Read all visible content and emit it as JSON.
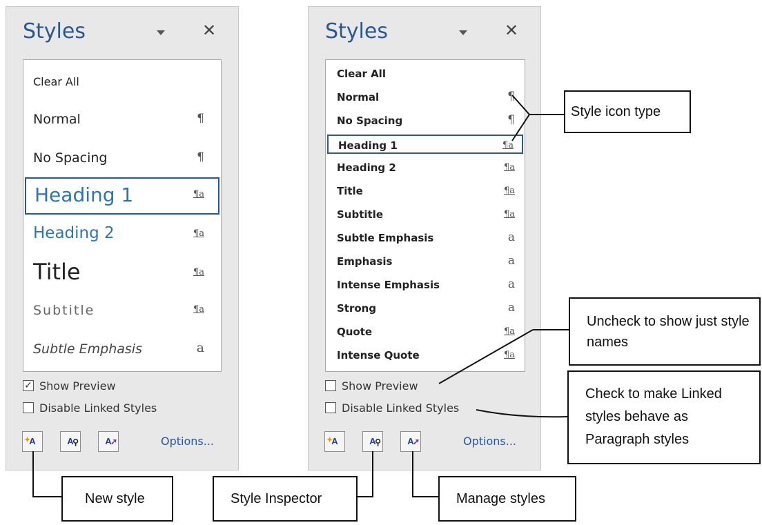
{
  "left_pane": {
    "title": "Styles",
    "styles": [
      {
        "name": "Clear All",
        "icon": ""
      },
      {
        "name": "Normal",
        "icon": "¶"
      },
      {
        "name": "No Spacing",
        "icon": "¶"
      },
      {
        "name": "Heading 1",
        "icon": "¶a",
        "selected": true
      },
      {
        "name": "Heading 2",
        "icon": "¶a"
      },
      {
        "name": "Title",
        "icon": "¶a"
      },
      {
        "name": "Subtitle",
        "icon": "¶a"
      },
      {
        "name": "Subtle Emphasis",
        "icon": "a"
      }
    ],
    "show_preview": {
      "label": "Show Preview",
      "checked": true
    },
    "disable_linked": {
      "label": "Disable Linked Styles",
      "checked": false
    },
    "options_label": "Options..."
  },
  "right_pane": {
    "title": "Styles",
    "styles": [
      {
        "name": "Clear All",
        "icon": ""
      },
      {
        "name": "Normal",
        "icon": "¶"
      },
      {
        "name": "No Spacing",
        "icon": "¶"
      },
      {
        "name": "Heading 1",
        "icon": "¶a",
        "selected": true
      },
      {
        "name": "Heading 2",
        "icon": "¶a"
      },
      {
        "name": "Title",
        "icon": "¶a"
      },
      {
        "name": "Subtitle",
        "icon": "¶a"
      },
      {
        "name": "Subtle Emphasis",
        "icon": "a"
      },
      {
        "name": "Emphasis",
        "icon": "a"
      },
      {
        "name": "Intense Emphasis",
        "icon": "a"
      },
      {
        "name": "Strong",
        "icon": "a"
      },
      {
        "name": "Quote",
        "icon": "¶a"
      },
      {
        "name": "Intense Quote",
        "icon": "¶a"
      }
    ],
    "show_preview": {
      "label": "Show Preview",
      "checked": false
    },
    "disable_linked": {
      "label": "Disable Linked Styles",
      "checked": false
    },
    "options_label": "Options..."
  },
  "buttons": {
    "new_style": "A",
    "style_inspector": "A",
    "manage_styles": "A"
  },
  "callouts": {
    "style_icon_type": "Style icon type",
    "uncheck_show_names": "Uncheck to show just style names",
    "check_linked": "Check to make Linked styles behave as Paragraph styles",
    "new_style": "New style",
    "style_inspector": "Style Inspector",
    "manage_styles": "Manage styles"
  },
  "colors": {
    "accent": "#2b5797",
    "pane_bg": "#e8e8e8",
    "heading_preview": "#2e74b5",
    "subtitle_preview": "#666666"
  }
}
